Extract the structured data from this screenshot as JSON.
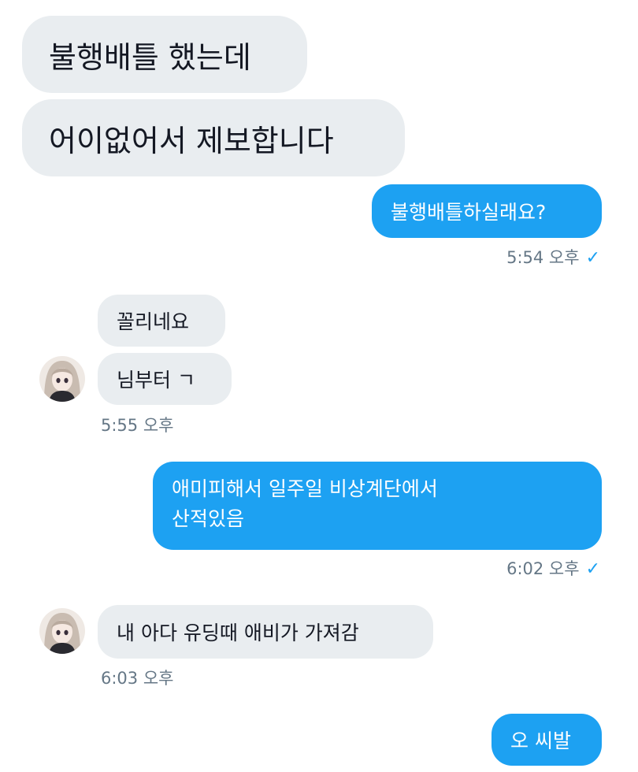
{
  "messages": [
    {
      "id": "m1",
      "text": "불행배틀 했는데"
    },
    {
      "id": "m2",
      "text": "어이없어서 제보합니다"
    },
    {
      "id": "m3",
      "text": "불행배틀하실래요?",
      "time": "5:54 오후",
      "read_mark": "✓"
    },
    {
      "id": "m4",
      "text": "꼴리네요"
    },
    {
      "id": "m5",
      "text": "님부터 ㄱ",
      "time": "5:55 오후"
    },
    {
      "id": "m6",
      "line1": "애미피해서 일주일 비상계단에서",
      "line2": "산적있음",
      "time": "6:02 오후",
      "read_mark": "✓"
    },
    {
      "id": "m7",
      "text": "내 아다 유딩때 애비가 가져감",
      "time": "6:03 오후"
    },
    {
      "id": "m8",
      "text": "오 씨발"
    }
  ],
  "colors": {
    "sent_bubble": "#1da1f2",
    "received_bubble": "#e9edf0",
    "timestamp": "#657786"
  },
  "icons": {
    "read_receipt": "check-icon",
    "avatar": "anime-character-avatar"
  }
}
